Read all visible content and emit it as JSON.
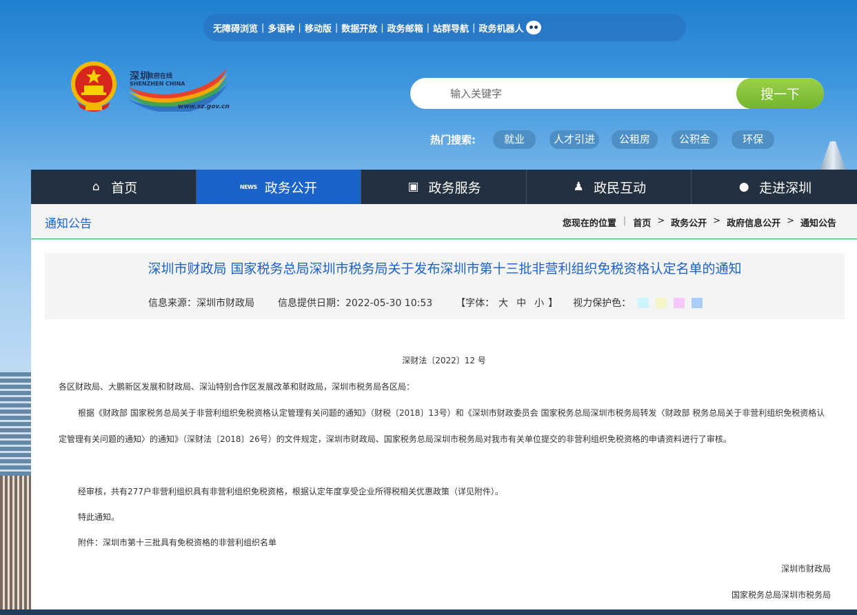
{
  "top_links": [
    "无障碍浏览",
    "多语种",
    "移动版",
    "数据开放",
    "政务邮箱",
    "站群导航",
    "政务机器人"
  ],
  "logo": {
    "cn": "深圳",
    "sub": "政府在线",
    "en": "SHENZHEN CHINA",
    "url": "www.sz.gov.cn"
  },
  "search": {
    "placeholder": "输入关键字",
    "button": "搜一下"
  },
  "hot_search": {
    "label": "热门搜索:",
    "tags": [
      "就业",
      "人才引进",
      "公租房",
      "公积金",
      "环保"
    ]
  },
  "nav": [
    {
      "label": "首页",
      "icon": "home-icon"
    },
    {
      "label": "政务公开",
      "icon": "news-icon"
    },
    {
      "label": "政务服务",
      "icon": "monitor-icon"
    },
    {
      "label": "政民互动",
      "icon": "users-icon"
    },
    {
      "label": "走进深圳",
      "icon": "chat-icon"
    }
  ],
  "nav_active": 1,
  "breadcrumb": {
    "section_title": "通知公告",
    "location_label": "您现在的位置",
    "items": [
      "首页",
      "政务公开",
      "政府信息公开",
      "通知公告"
    ]
  },
  "article": {
    "title": "深圳市财政局 国家税务总局深圳市税务局关于发布深圳市第十三批非营利组织免税资格认定名单的通知",
    "source": "信息来源：深圳市财政局",
    "date": "信息提供日期：2022-05-30 10:53",
    "font_label": "【字体：",
    "font_sizes": [
      "大",
      "中",
      "小"
    ],
    "font_close": "】",
    "eye_label": "视力保护色：",
    "eye_colors": [
      "#ccf5fb",
      "#f5f5c8",
      "#f7c8f7",
      "#a9cdf7"
    ],
    "doc_no": "深财法〔2022〕12 号",
    "recipients": "各区财政局、大鹏新区发展和财政局、深汕特别合作区发展改革和财政局，深圳市税务局各区局：",
    "para1": "根据《财政部 国家税务总局关于非营利组织免税资格认定管理有关问题的通知》（财税〔2018〕13号）和《深圳市财政委员会 国家税务总局深圳市税务局转发〈财政部 税务总局关于非营利组织免税资格认定管理有关问题的通知〉的通知》（深财法〔2018〕26号）的文件规定，深圳市财政局、国家税务总局深圳市税务局对我市有关单位提交的非营利组织免税资格的申请资料进行了审核。",
    "para2": "经审核，共有277户非营利组织具有非营利组织免税资格，根据认定年度享受企业所得税相关优惠政策（详见附件）。",
    "para3": "特此通知。",
    "attachment": "附件：深圳市第十三批具有免税资格的非营利组织名单",
    "sign1": "深圳市财政局",
    "sign2": "国家税务总局深圳市税务局"
  }
}
